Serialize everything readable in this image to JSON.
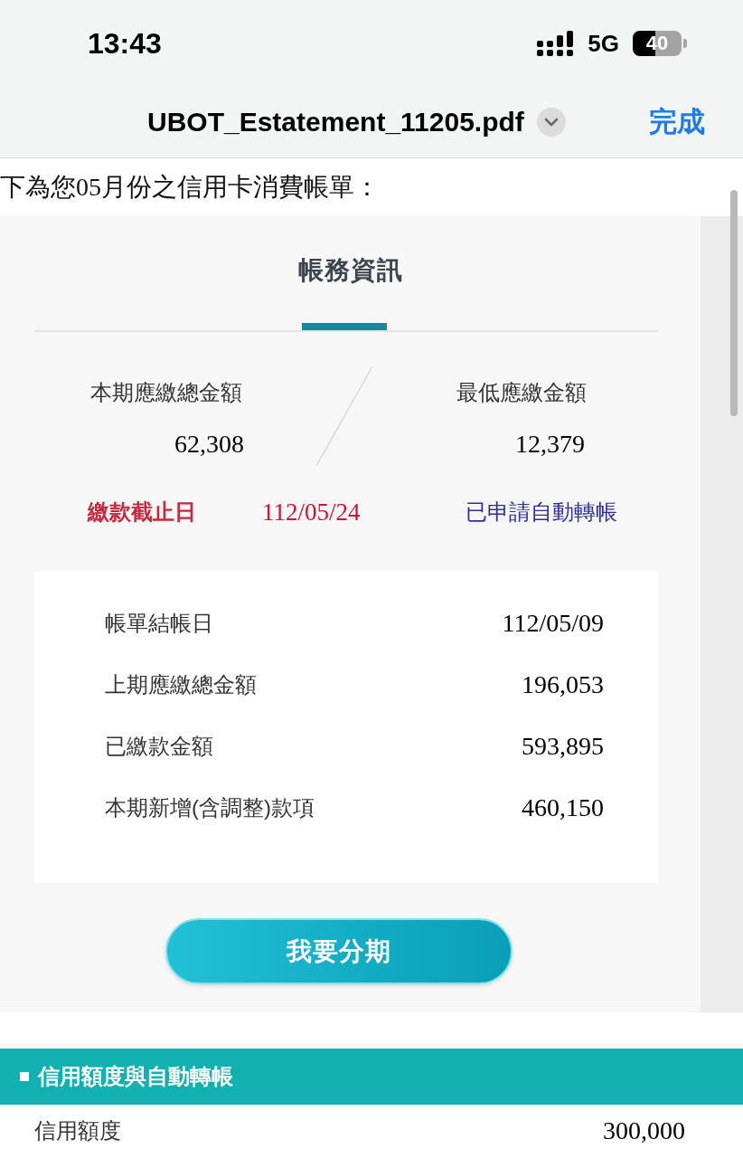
{
  "status_bar": {
    "time": "13:43",
    "network": "5G",
    "battery": "40"
  },
  "header": {
    "title": "UBOT_Estatement_11205.pdf",
    "done_button": "完成"
  },
  "intro_text": "下為您05月份之信用卡消費帳單：",
  "billing_card": {
    "title": "帳務資訊",
    "summary": [
      {
        "label": "本期應繳總金額",
        "value": "62,308"
      },
      {
        "label": "最低應繳金額",
        "value": "12,379"
      }
    ],
    "due": {
      "label": "繳款截止日",
      "date": "112/05/24",
      "autopay_status": "已申請自動轉帳"
    },
    "details": [
      {
        "label": "帳單結帳日",
        "value": "112/05/09"
      },
      {
        "label": "上期應繳總金額",
        "value": "196,053"
      },
      {
        "label": "已繳款金額",
        "value": "593,895"
      },
      {
        "label": "本期新增(含調整)款項",
        "value": "460,150"
      }
    ],
    "installment_button": "我要分期"
  },
  "credit_section": {
    "title": "信用額度與自動轉帳",
    "rows": [
      {
        "label": "信用額度",
        "value": "300,000"
      }
    ]
  }
}
